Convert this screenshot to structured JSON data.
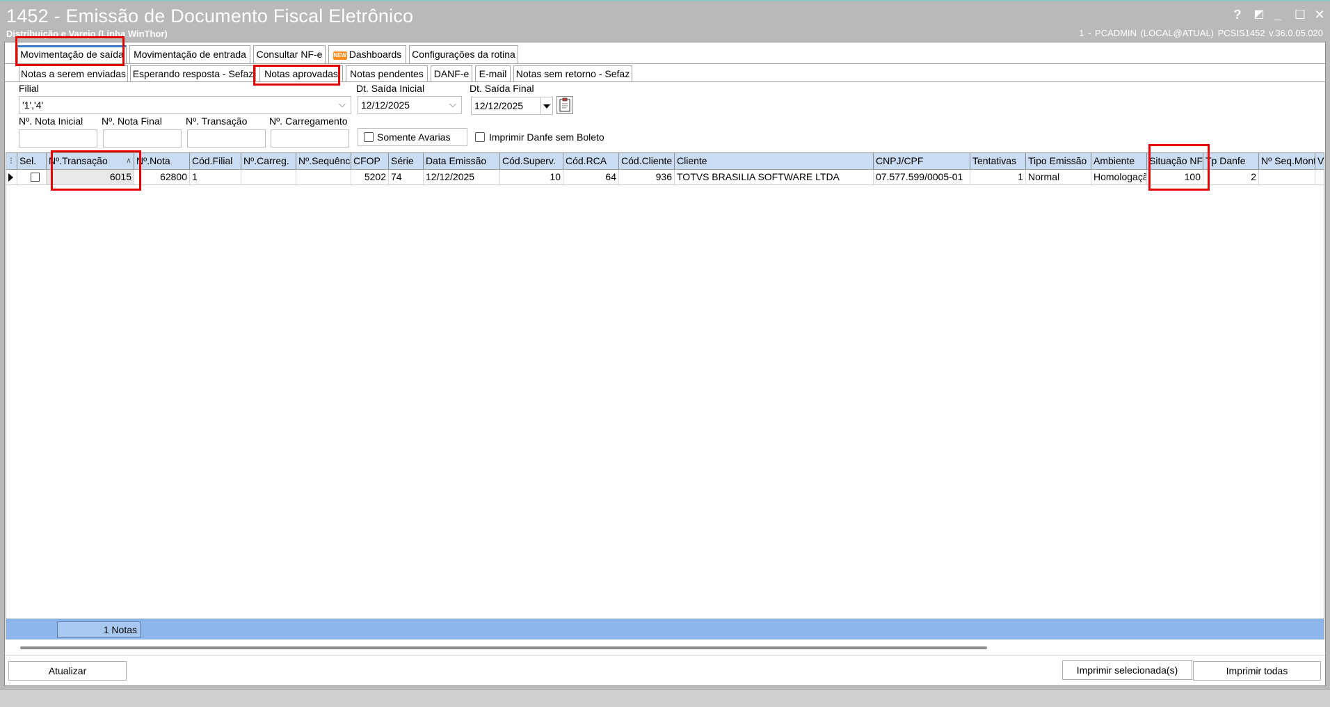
{
  "window": {
    "title": "1452 - Emissão de Documento Fiscal Eletrônico",
    "subtitle": "Distribuição e Varejo (Linha WinThor)",
    "user_info": "1 - PCADMIN (LOCAL@ATUAL)   PCSIS1452  v.36.0.05.020",
    "controls": {
      "help": "?",
      "restore": "◩",
      "minimize": "_",
      "maximize": "☐",
      "close": "✕"
    }
  },
  "main_tabs": [
    {
      "label": "Movimentação de saída",
      "active": true
    },
    {
      "label": "Movimentação de entrada"
    },
    {
      "label": "Consultar NF-e"
    },
    {
      "label": "Dashboards",
      "badge": "NEW"
    },
    {
      "label": "Configurações da rotina"
    }
  ],
  "sub_tabs": [
    {
      "label": "Notas a serem enviadas"
    },
    {
      "label": "Esperando resposta - Sefaz"
    },
    {
      "label": "Notas aprovadas",
      "active": true
    },
    {
      "label": "Notas pendentes"
    },
    {
      "label": "DANF-e"
    },
    {
      "label": "E-mail"
    },
    {
      "label": "Notas sem retorno - Sefaz"
    }
  ],
  "filters": {
    "filial_label": "Filial",
    "filial_value": "'1','4'",
    "dt_inicial_label": "Dt. Saída Inicial",
    "dt_inicial_value": "12/12/2025",
    "dt_final_label": "Dt. Saída Final",
    "dt_final_value": "12/12/2025",
    "nota_inicial_label": "Nº. Nota Inicial",
    "nota_final_label": "Nº. Nota Final",
    "transacao_label": "Nº. Transação",
    "carregamento_label": "Nº. Carregamento",
    "somente_avarias_label": "Somente Avarias",
    "imprimir_danfe_label": "Imprimir Danfe sem Boleto"
  },
  "grid": {
    "columns": [
      "Sel.",
      "Nº.Transação",
      "Nº.Nota",
      "Cód.Filial",
      "Nº.Carreg.",
      "Nº.Sequênci",
      "CFOP",
      "Série",
      "Data Emissão",
      "Cód.Superv.",
      "Cód.RCA",
      "Cód.Cliente",
      "Cliente",
      "CNPJ/CPF",
      "Tentativas",
      "Tipo Emissão",
      "Ambiente",
      "Situação NFe",
      "Tp Danfe",
      "Nº Seq.Mont",
      "V"
    ],
    "sort_indicator": "∧",
    "rows": [
      [
        "",
        "6015",
        "62800",
        "1",
        "",
        "",
        "5202",
        "74",
        "12/12/2025",
        "10",
        "64",
        "936",
        "TOTVS BRASILIA SOFTWARE LTDA",
        "07.577.599/0005-01",
        "1",
        "Normal",
        "Homologação",
        "100",
        "2",
        "",
        ""
      ]
    ],
    "footer_count": "1 Notas"
  },
  "buttons": {
    "atualizar": "Atualizar",
    "imprimir_selecionadas": "Imprimir selecionada(s)",
    "imprimir_todas": "Imprimir todas"
  },
  "colors": {
    "highlight": "#e60000",
    "grid_header": "#cadcf1",
    "grid_footer": "#8db6ea",
    "title_bar": "#b9b9b9"
  }
}
